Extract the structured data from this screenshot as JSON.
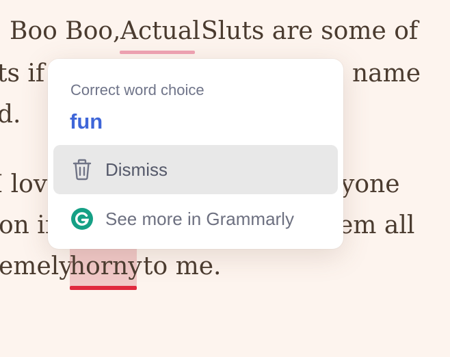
{
  "document": {
    "lines": [
      {
        "text": "Boo Boo,",
        "id": "l1a"
      },
      {
        "text": "Actual",
        "id": "l1b"
      },
      {
        "text": "Sluts are some of",
        "id": "l1c"
      },
      {
        "text": "ts if",
        "id": "l2a"
      },
      {
        "text": "name",
        "id": "l2b"
      },
      {
        "text": "d.",
        "id": "l3"
      },
      {
        "text": "I lov",
        "id": "l4a"
      },
      {
        "text": "yone",
        "id": "l4b"
      },
      {
        "text": "on in",
        "id": "l5a"
      },
      {
        "text": "em all",
        "id": "l5b"
      },
      {
        "text": "emely",
        "id": "l6a"
      },
      {
        "text": "horny",
        "id": "l6b"
      },
      {
        "text": "to me.",
        "id": "l6c"
      }
    ]
  },
  "suggestion_card": {
    "category": "Correct word choice",
    "suggestion": "fun",
    "dismiss_label": "Dismiss",
    "more_label": "See more in Grammarly"
  },
  "colors": {
    "accent_blue": "#3f66d8",
    "grammarly_green": "#15a085",
    "error_red": "#e0283e",
    "soft_pink": "#f0a3b3"
  },
  "icons": {
    "dismiss": "trash-icon",
    "more": "grammarly-logo-icon"
  }
}
